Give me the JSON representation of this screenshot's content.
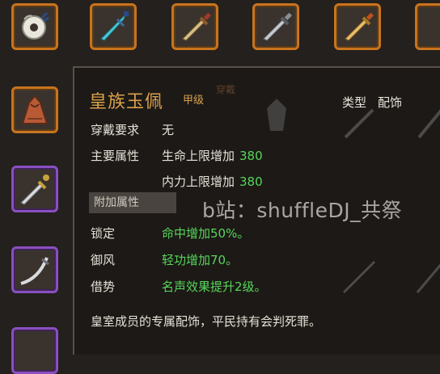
{
  "inventory": {
    "slots": [
      {
        "icon": "jade-pendant-icon"
      },
      {
        "icon": "cyan-sword-icon"
      },
      {
        "icon": "bronze-sword-icon"
      },
      {
        "icon": "silver-sword-icon"
      },
      {
        "icon": "golden-sword-icon"
      },
      {
        "icon": "red-cloak-icon"
      },
      {
        "icon": "ornate-sword-icon"
      },
      {
        "icon": "curved-sword-icon"
      }
    ]
  },
  "tooltip": {
    "name": "皇族玉佩",
    "grade": "甲级",
    "stamp": "穿戴",
    "type_label": "类型",
    "type_value": "配饰",
    "requirement_label": "穿戴要求",
    "requirement_value": "无",
    "main_attr_label": "主要属性",
    "main_attrs": [
      {
        "text": "生命上限增加",
        "value": "380"
      },
      {
        "text": "内力上限增加",
        "value": "380"
      }
    ],
    "extra_attr_label": "附加属性",
    "extra_attrs": [
      {
        "label": "锁定",
        "value": "命中增加50%。"
      },
      {
        "label": "御风",
        "value": "轻功增加70。"
      },
      {
        "label": "借势",
        "value": "名声效果提升2级。"
      }
    ],
    "description": "皇室成员的专属配饰，平民持有会判死罪。"
  },
  "watermark": "b站：shuffleDJ_共祭",
  "colors": {
    "item_name": "#d9a04a",
    "bonus_text": "#57d65a",
    "slot_orange": "#c8741e",
    "slot_purple": "#8a4fc0"
  }
}
